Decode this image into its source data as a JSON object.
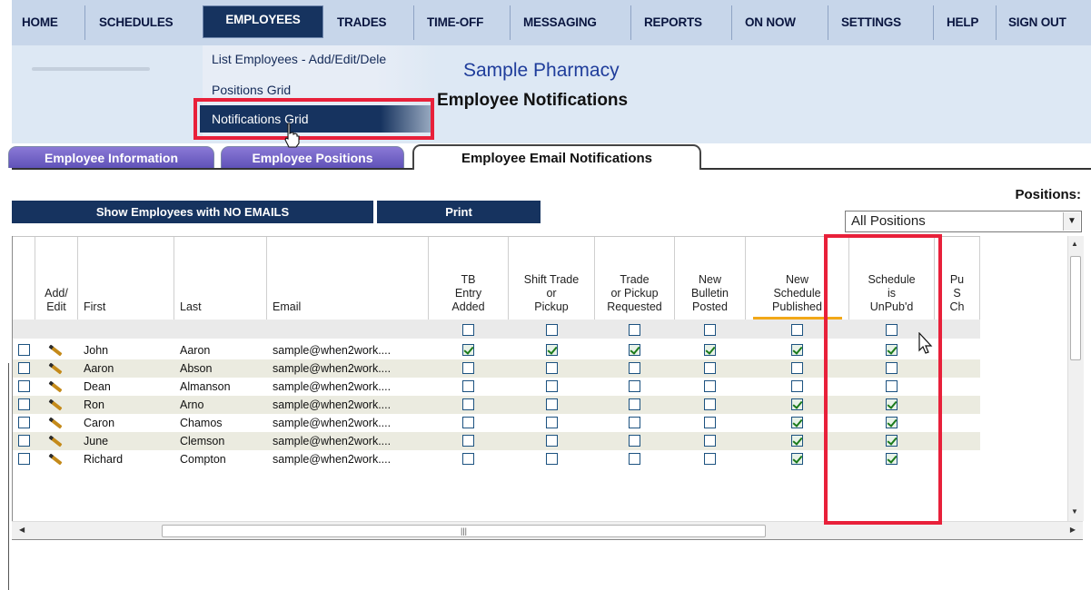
{
  "nav": {
    "items": [
      {
        "label": "HOME"
      },
      {
        "label": "SCHEDULES"
      },
      {
        "label": "EMPLOYEES"
      },
      {
        "label": "TRADES"
      },
      {
        "label": "TIME-OFF"
      },
      {
        "label": "MESSAGING"
      },
      {
        "label": "REPORTS"
      },
      {
        "label": "ON NOW"
      },
      {
        "label": "SETTINGS"
      },
      {
        "label": "HELP"
      },
      {
        "label": "SIGN OUT"
      }
    ],
    "active": "EMPLOYEES"
  },
  "dropdown": {
    "items": [
      {
        "label": "List Employees - Add/Edit/Dele"
      },
      {
        "label": "Positions Grid"
      },
      {
        "label": "Notifications Grid"
      }
    ],
    "highlighted": "Notifications Grid"
  },
  "header": {
    "company": "Sample Pharmacy",
    "title": "Employee Notifications"
  },
  "tabs": [
    {
      "label": "Employee Information"
    },
    {
      "label": "Employee Positions"
    },
    {
      "label": "Employee Email Notifications"
    }
  ],
  "selected_tab": "Employee Email Notifications",
  "toolbar": {
    "show_no_emails_label": "Show Employees with NO EMAILS",
    "print_label": "Print"
  },
  "positions": {
    "label": "Positions:",
    "selected": "All Positions"
  },
  "grid": {
    "columns": [
      {
        "label": ""
      },
      {
        "label": "Add/\nEdit"
      },
      {
        "label": "First"
      },
      {
        "label": "Last"
      },
      {
        "label": "Email"
      },
      {
        "label": "TB\nEntry\nAdded"
      },
      {
        "label": "Shift Trade\nor\nPickup"
      },
      {
        "label": "Trade\nor Pickup\nRequested"
      },
      {
        "label": "New\nBulletin\nPosted"
      },
      {
        "label": "New\nSchedule\nPublished"
      },
      {
        "label": "Schedule\nis\nUnPub'd"
      },
      {
        "label": "Pu\nS\nCh"
      }
    ],
    "rows": [
      {
        "first": "John",
        "last": "Aaron",
        "email": "sample@when2work....",
        "flags": [
          true,
          true,
          true,
          true,
          true,
          true
        ]
      },
      {
        "first": "Aaron",
        "last": "Abson",
        "email": "sample@when2work....",
        "flags": [
          false,
          false,
          false,
          false,
          false,
          false
        ]
      },
      {
        "first": "Dean",
        "last": "Almanson",
        "email": "sample@when2work....",
        "flags": [
          false,
          false,
          false,
          false,
          false,
          false
        ]
      },
      {
        "first": "Ron",
        "last": "Arno",
        "email": "sample@when2work....",
        "flags": [
          false,
          false,
          false,
          false,
          true,
          true
        ]
      },
      {
        "first": "Caron",
        "last": "Chamos",
        "email": "sample@when2work....",
        "flags": [
          false,
          false,
          false,
          false,
          true,
          true
        ]
      },
      {
        "first": "June",
        "last": "Clemson",
        "email": "sample@when2work....",
        "flags": [
          false,
          false,
          false,
          false,
          true,
          true
        ]
      },
      {
        "first": "Richard",
        "last": "Compton",
        "email": "sample@when2work....",
        "flags": [
          false,
          false,
          false,
          false,
          true,
          true
        ]
      }
    ]
  },
  "colors": {
    "nav_bg": "#c7d6ea",
    "nav_active": "#16335f",
    "highlight_box": "#e8203a",
    "tab_inactive": "#6e60c6",
    "header_bg": "#dde8f4",
    "company_text": "#1f3d9b"
  }
}
